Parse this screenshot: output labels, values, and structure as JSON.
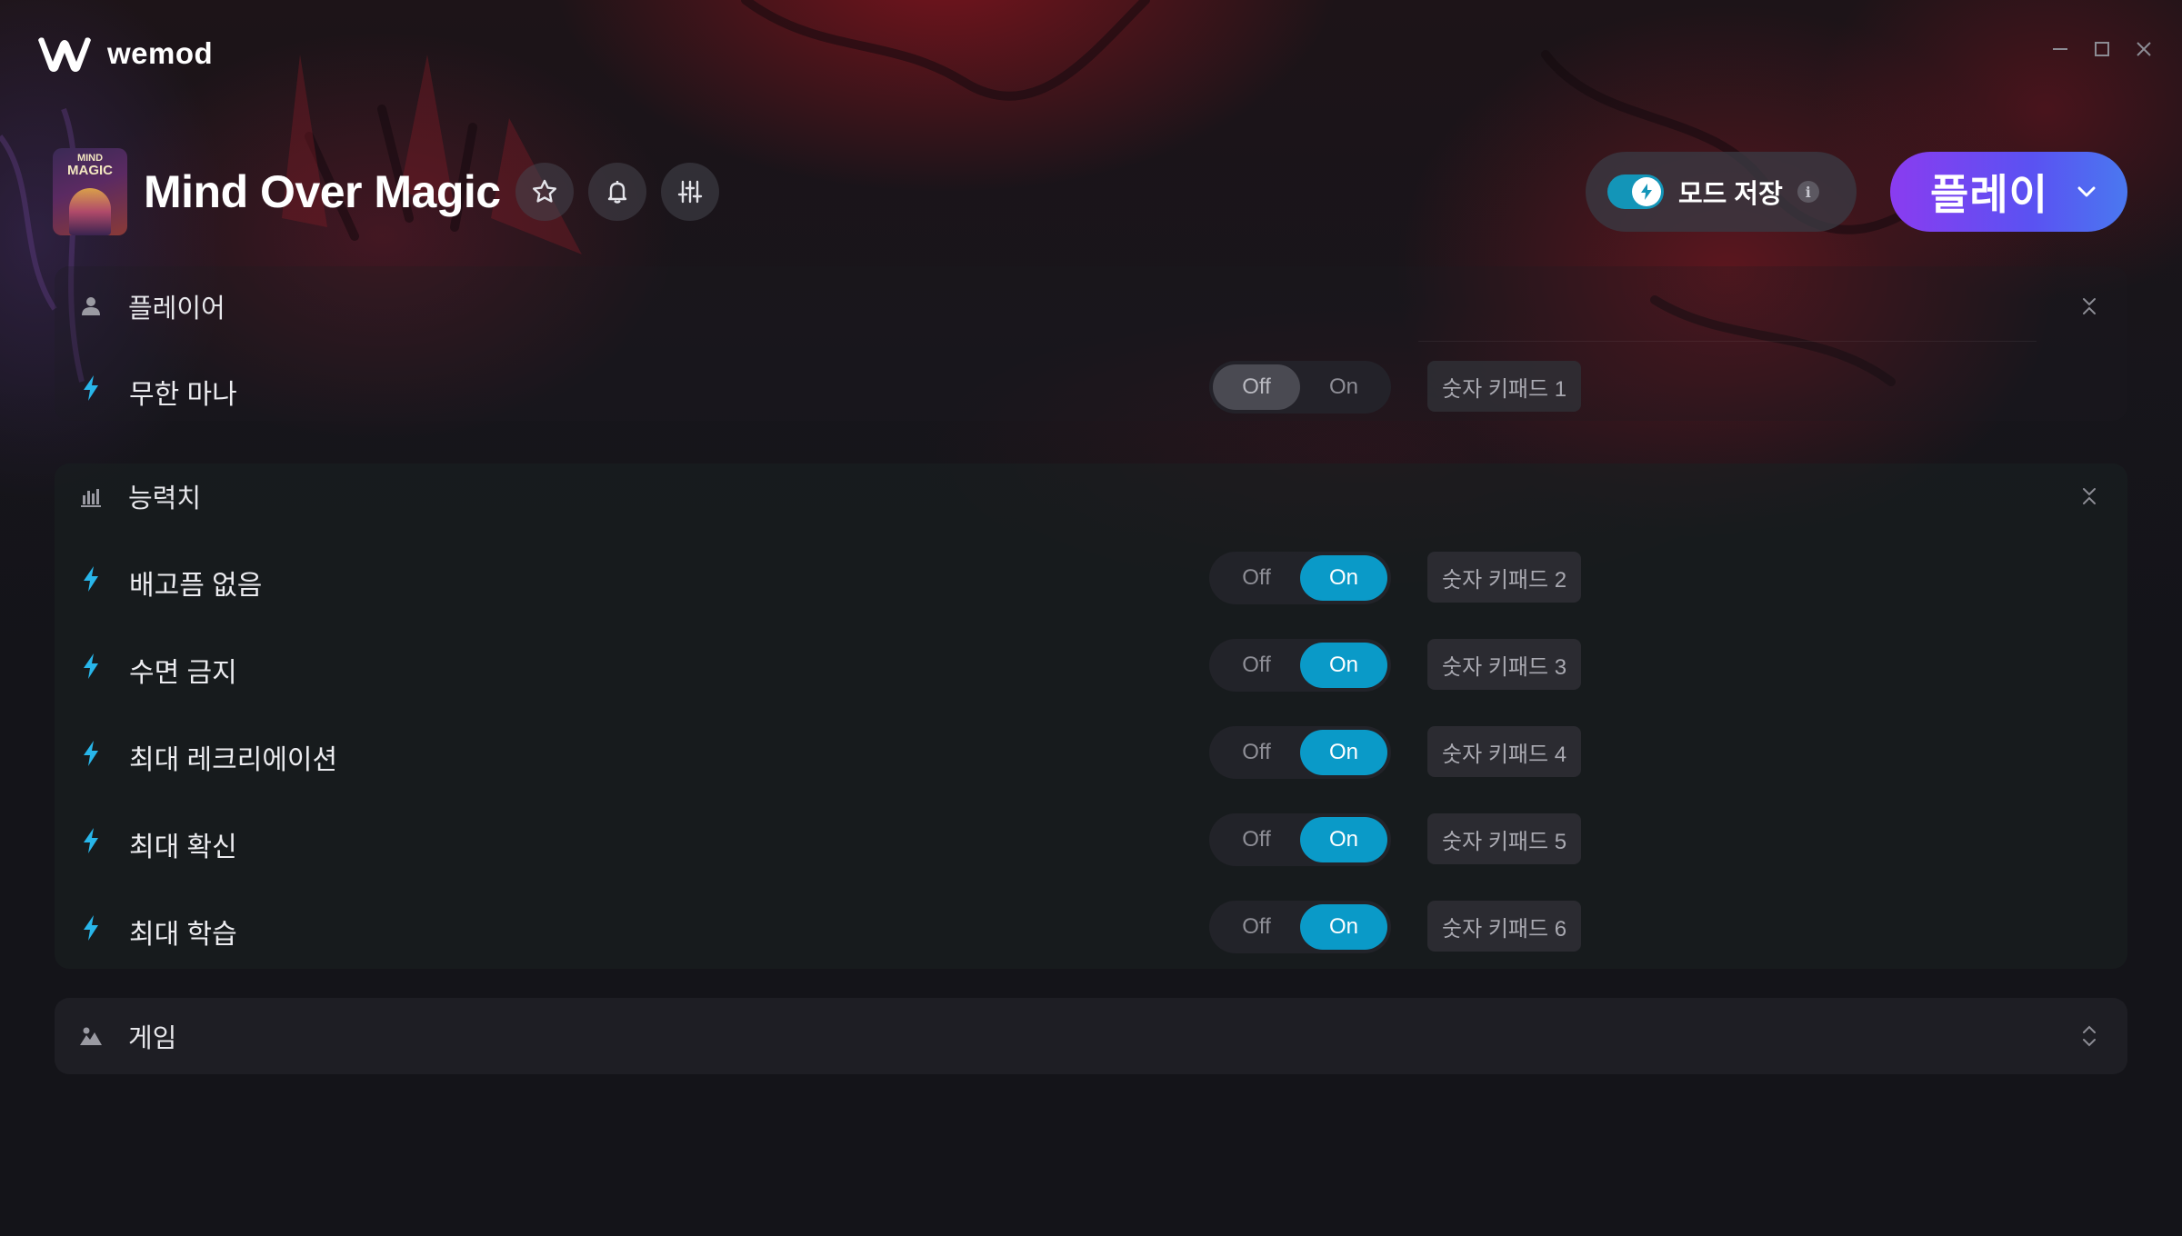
{
  "app": {
    "name": "wemod"
  },
  "window_controls": {
    "minimize": "minimize-icon",
    "maximize": "maximize-icon",
    "close": "close-icon"
  },
  "game": {
    "title": "Mind Over Magic",
    "thumbnail_text": {
      "line1": "MIND",
      "line2": "MAGIC"
    }
  },
  "header": {
    "favorite_icon": "star-icon",
    "notify_icon": "bell-icon",
    "settings_icon": "sliders-icon",
    "save_mods_label": "모드 저장",
    "save_mods_enabled": true,
    "save_mods_info": "i",
    "play_label": "플레이"
  },
  "categories": [
    {
      "label": "플레이어",
      "icon": "person-icon",
      "mods": [
        {
          "label": "무한 마나",
          "state": "Off",
          "hotkey": "숫자 키패드 1"
        }
      ]
    },
    {
      "label": "능력치",
      "icon": "bar-chart-icon",
      "mods": [
        {
          "label": "배고픔 없음",
          "state": "On",
          "hotkey": "숫자 키패드 2"
        },
        {
          "label": "수면 금지",
          "state": "On",
          "hotkey": "숫자 키패드 3"
        },
        {
          "label": "최대 레크리에이션",
          "state": "On",
          "hotkey": "숫자 키패드 4"
        },
        {
          "label": "최대 확신",
          "state": "On",
          "hotkey": "숫자 키패드 5"
        },
        {
          "label": "최대 학습",
          "state": "On",
          "hotkey": "숫자 키패드 6"
        }
      ]
    },
    {
      "label": "게임",
      "icon": "landscape-icon",
      "mods": []
    }
  ],
  "switch_labels": {
    "off": "Off",
    "on": "On"
  },
  "colors": {
    "accent_on": "#0a9ac8",
    "bolt": "#28b6ea",
    "play_gradient_start": "#8a3cf0",
    "play_gradient_end": "#4a78f0"
  }
}
